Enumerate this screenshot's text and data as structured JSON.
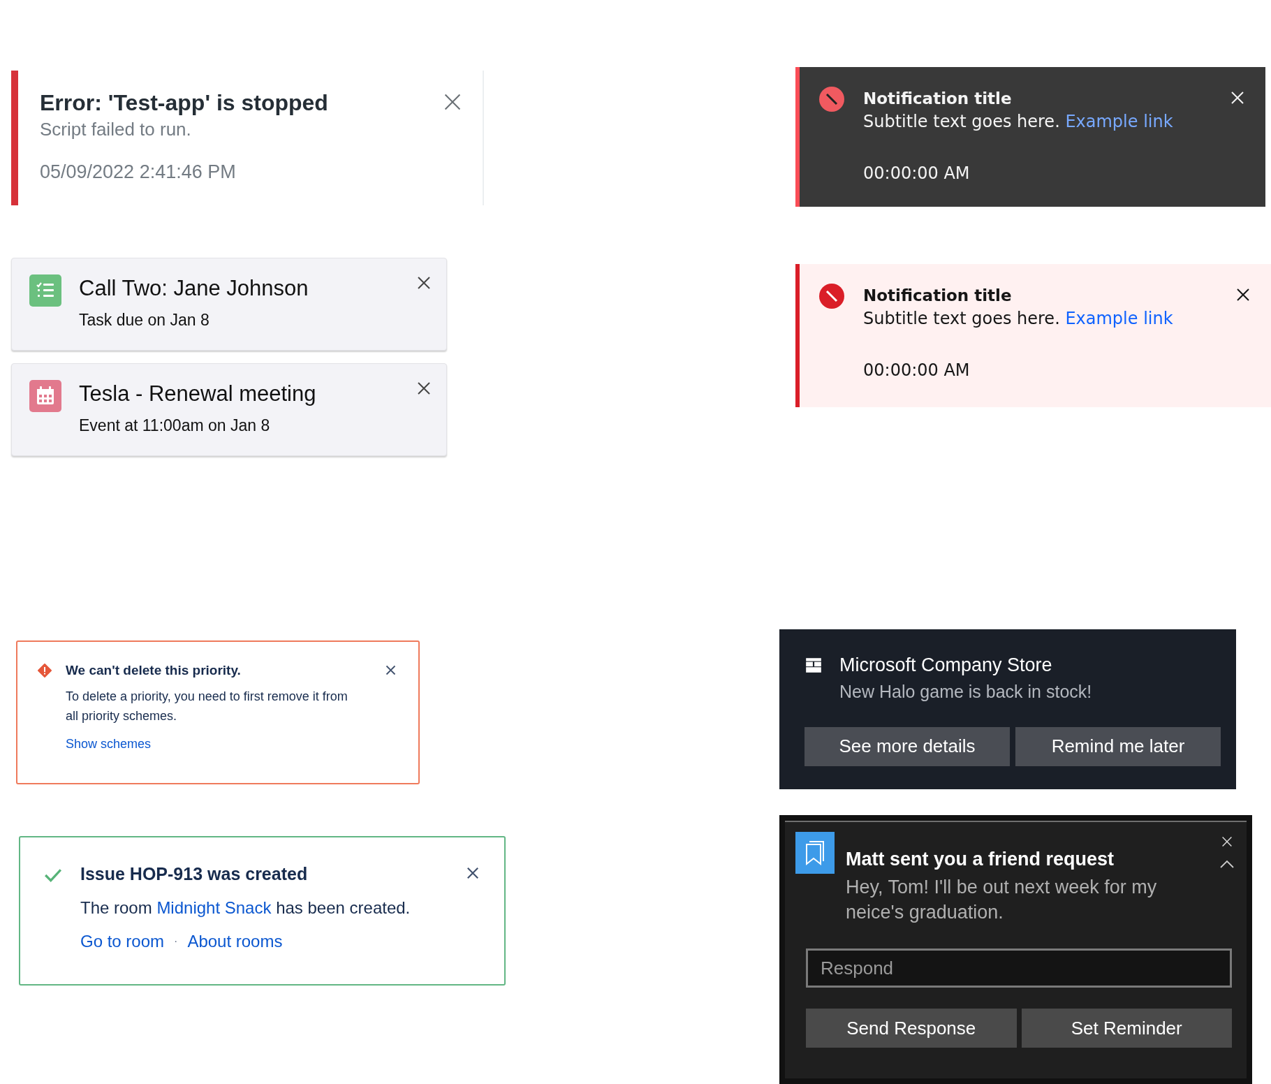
{
  "left_stack": [
    {
      "kind": "error_stripe",
      "title": "Error: 'Test-app' is stopped",
      "subtitle": "Script failed to run.",
      "timestamp": "05/09/2022 2:41:46 PM"
    },
    {
      "kind": "task",
      "title": "Call Two: Jane Johnson",
      "subtitle": "Task due on Jan 8"
    },
    {
      "kind": "event",
      "title": "Tesla - Renewal meeting",
      "subtitle": "Event at 11:00am on Jan 8"
    },
    {
      "kind": "warning_box",
      "title": "We can't delete this priority.",
      "body": "To delete a priority, you need to first remove it from all priority schemes.",
      "links": [
        "Show schemes"
      ]
    },
    {
      "kind": "success_box",
      "title": "Issue HOP-913 was created",
      "body_before": "The room ",
      "body_link": "Midnight Snack",
      "body_after": " has been created.",
      "links": [
        "Go to room",
        "About rooms"
      ],
      "link_separator": "·"
    }
  ],
  "right_stack": [
    {
      "kind": "carbon",
      "dark": true,
      "title": "Notification title",
      "subtitle": "Subtitle text goes here.",
      "link": "Example link",
      "timestamp": "00:00:00 AM"
    },
    {
      "kind": "carbon",
      "dark": false,
      "title": "Notification title",
      "subtitle": "Subtitle text goes here.",
      "link": "Example link",
      "timestamp": "00:00:00 AM"
    },
    {
      "kind": "toast_actions",
      "title": "Microsoft Company Store",
      "subtitle": "New Halo game is back in stock!",
      "buttons": [
        "See more details",
        "Remind me later"
      ]
    },
    {
      "kind": "toast_reply",
      "title": "Matt sent you a friend request",
      "subtitle": "Hey, Tom! I'll be out next week for my neice's graduation.",
      "input": {
        "placeholder": "Respond"
      },
      "buttons": [
        "Send Response",
        "Set Reminder"
      ]
    }
  ]
}
